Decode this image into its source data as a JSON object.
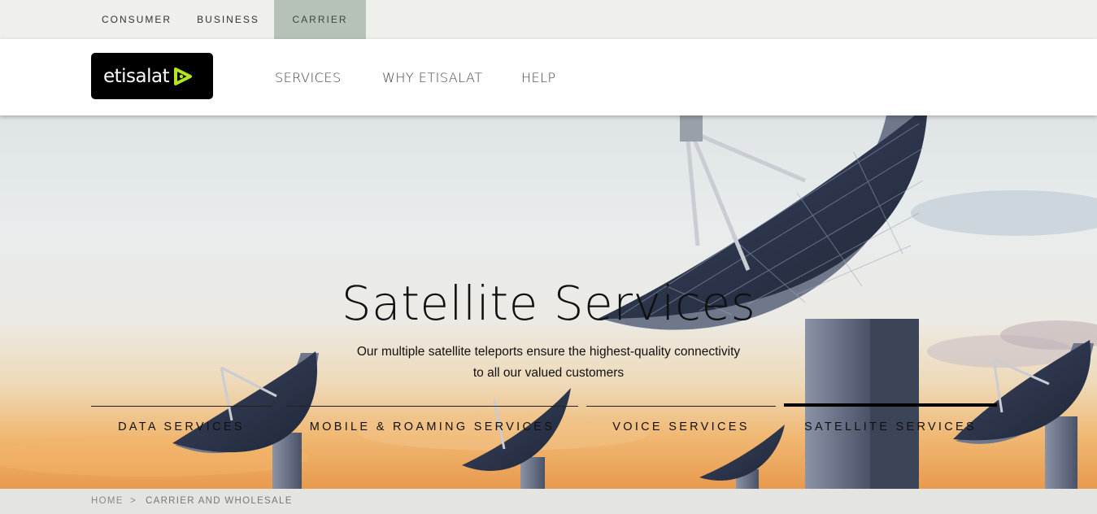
{
  "segments": [
    {
      "label": "CONSUMER"
    },
    {
      "label": "BUSINESS"
    },
    {
      "label": "CARRIER",
      "active": true
    }
  ],
  "header": {
    "logo_text": "etisalat",
    "nav": [
      {
        "label": "SERVICES"
      },
      {
        "label": "WHY ETISALAT"
      },
      {
        "label": "HELP"
      }
    ]
  },
  "hero": {
    "title": "Satellite Services",
    "subtitle_line1": "Our multiple satellite teleports ensure the highest-quality connectivity",
    "subtitle_line2": "to all our valued customers",
    "tabs": [
      {
        "label": "DATA SERVICES"
      },
      {
        "label": "MOBILE & ROAMING SERVICES"
      },
      {
        "label": "VOICE SERVICES"
      },
      {
        "label": "SATELLITE SERVICES",
        "active": true
      }
    ]
  },
  "breadcrumb": {
    "home": "HOME",
    "separator": ">",
    "current": "CARRIER AND WHOLESALE"
  },
  "colors": {
    "topbar_bg": "#efefeb",
    "carrier_active_bg": "#b6c2b7",
    "logo_bg": "#000000",
    "logo_accent": "#b5e61d",
    "breadcrumb_bg": "#e4e5e0"
  }
}
